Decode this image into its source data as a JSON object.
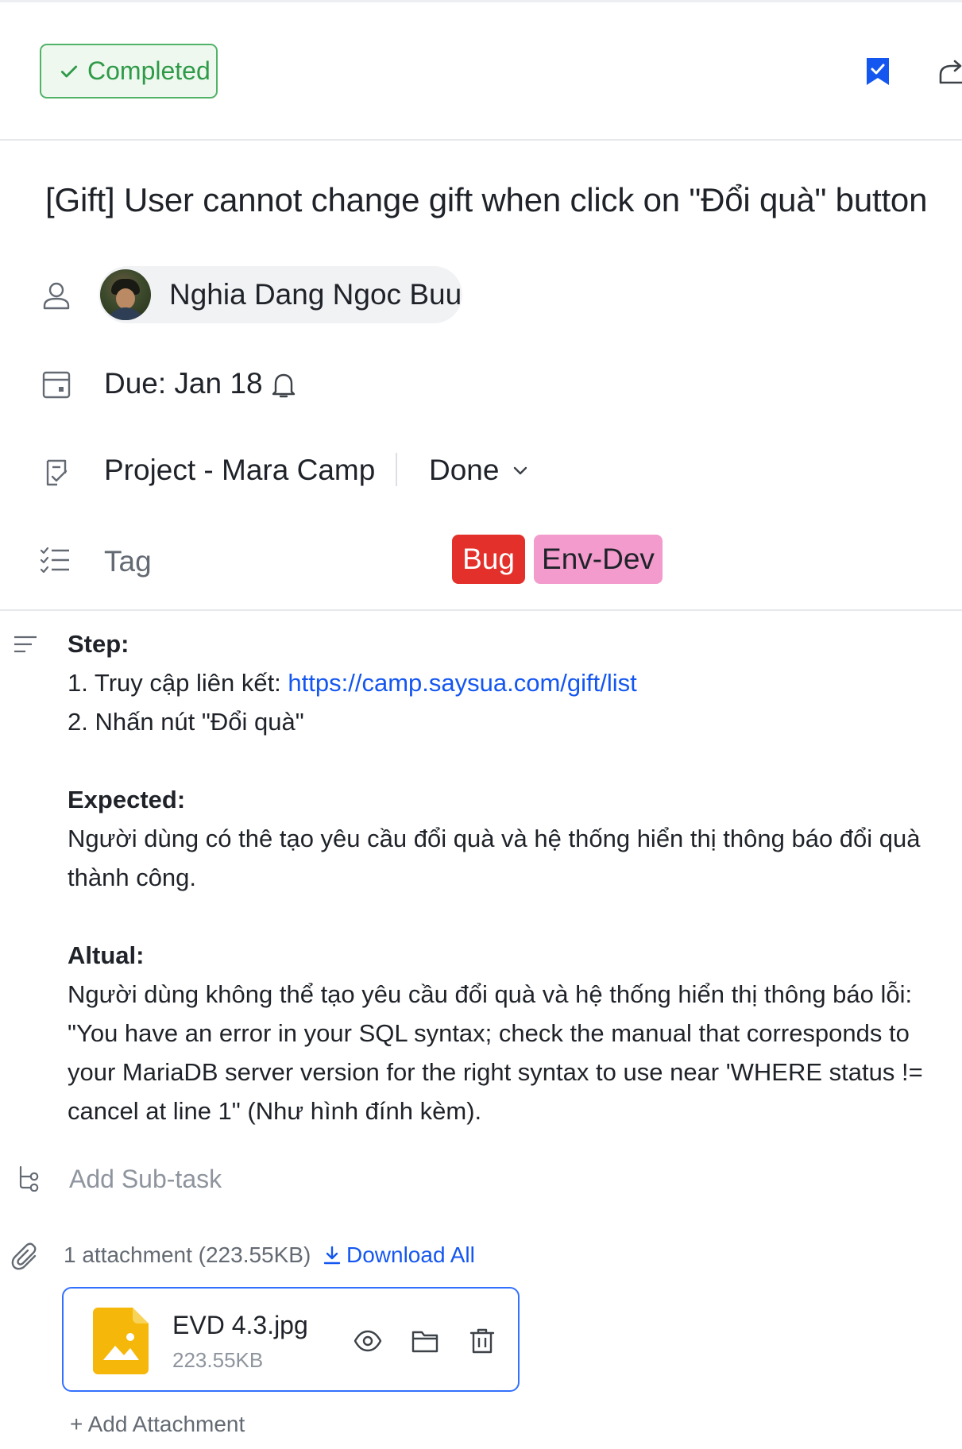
{
  "header": {
    "status_label": "Completed",
    "icons": [
      "check-icon",
      "bookmark-icon",
      "share-icon"
    ]
  },
  "task": {
    "title": "[Gift] User cannot change gift when click on \"Đổi quà\" button",
    "assignee": {
      "name": "Nghia Dang Ngoc Buu"
    },
    "due": "Due: Jan 18",
    "project": "Project - Mara Camp",
    "section": "Done",
    "tag_label": "Tag",
    "tags": [
      {
        "label": "Bug",
        "color": "#e3302b"
      },
      {
        "label": "Env-Dev",
        "color": "#f29bcc"
      }
    ]
  },
  "description": {
    "step_heading": "Step:",
    "step_1_prefix": "1. Truy cập liên kết: ",
    "step_1_link": "https://camp.saysua.com/gift/list",
    "step_2": "2. Nhấn nút \"Đổi quà\"",
    "expected_heading": "Expected:",
    "expected_text": "Người dùng có thê tạo yêu cầu đổi quà và hệ thống hiển thị thông báo đổi quà thành công.",
    "actual_heading": "Altual:",
    "actual_text": "Người dùng không thể tạo yêu cầu đổi quà và hệ thống hiển thị thông báo lỗi: \"You have an error in your SQL syntax; check the manual that corresponds to your MariaDB server version for the right syntax to use near 'WHERE status != cancel at line 1\" (Như hình đính kèm)."
  },
  "subtask": {
    "placeholder": "Add Sub-task"
  },
  "attachments": {
    "summary": "1 attachment (223.55KB)",
    "download_all": "Download All",
    "files": [
      {
        "name": "EVD 4.3.jpg",
        "size": "223.55KB"
      }
    ],
    "add_label": "+ Add Attachment"
  },
  "colors": {
    "accent": "#1456f0",
    "status_green": "#2f9a48",
    "card_border": "#3370ff"
  }
}
